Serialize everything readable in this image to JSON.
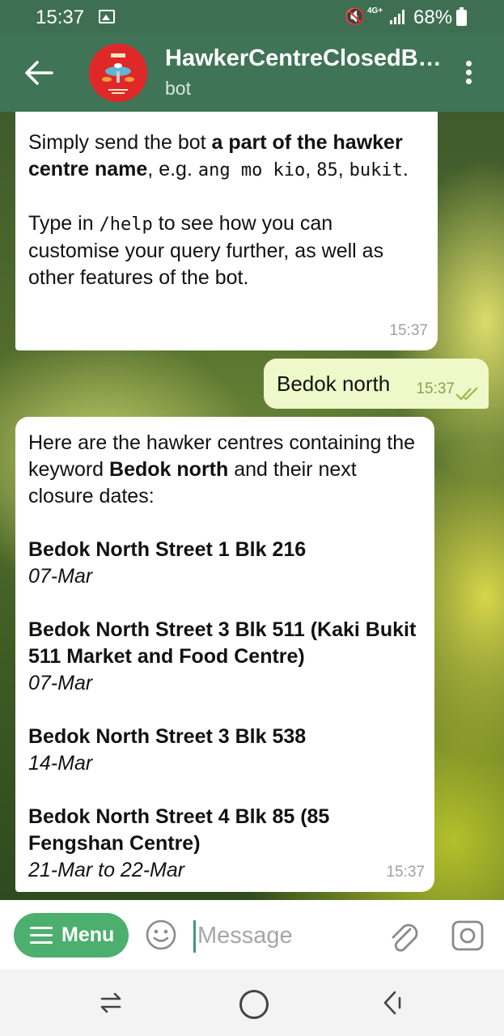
{
  "status_bar": {
    "time": "15:37",
    "network": "4G+",
    "battery": "68%"
  },
  "header": {
    "title": "HawkerCentreClosedB…",
    "subtitle": "bot",
    "avatar_icon": "hawker-centre-logo-icon"
  },
  "messages": [
    {
      "direction": "incoming",
      "time": "15:37",
      "p1_prefix": "Simply send the bot ",
      "p1_bold": "a part of the hawker centre name",
      "p1_mid": ", e.g. ",
      "ex1": "ang mo kio",
      "sep1": ", ",
      "ex2": "85",
      "sep2": ", ",
      "ex3": "bukit",
      "p1_end": ".",
      "p2_prefix": "Type in ",
      "p2_cmd": "/help",
      "p2_rest": " to see how you can customise your query further, as well as other features of the bot."
    },
    {
      "direction": "outgoing",
      "text": "Bedok north",
      "time": "15:37",
      "status": "read"
    },
    {
      "direction": "incoming",
      "time": "15:37",
      "intro_prefix": "Here are the hawker centres containing the keyword ",
      "intro_keyword": "Bedok north",
      "intro_suffix": " and their next closure dates:",
      "results": [
        {
          "name": "Bedok North Street 1 Blk 216",
          "dates": "07-Mar"
        },
        {
          "name": "Bedok North Street 3 Blk 511 (Kaki Bukit 511 Market and Food Centre)",
          "dates": "07-Mar"
        },
        {
          "name": "Bedok North Street 3 Blk 538",
          "dates": "14-Mar"
        },
        {
          "name": "Bedok North Street 4 Blk 85 (85 Fengshan Centre)",
          "dates": "21-Mar to 22-Mar"
        }
      ]
    }
  ],
  "input_bar": {
    "menu_label": "Menu",
    "placeholder": "Message"
  },
  "colors": {
    "app_bar": "#3f7556",
    "accent": "#4caf6e",
    "outgoing_bubble": "#eff8c8"
  }
}
